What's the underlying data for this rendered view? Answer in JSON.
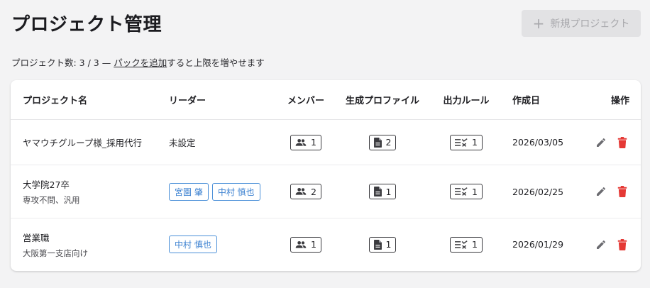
{
  "header": {
    "title": "プロジェクト管理",
    "new_button": "新規プロジェクト",
    "count_prefix": "プロジェクト数: 3 / 3 — ",
    "count_link": "パックを追加",
    "count_suffix": "すると上限を増やせます"
  },
  "table": {
    "columns": {
      "name": "プロジェクト名",
      "leader": "リーダー",
      "members": "メンバー",
      "profile": "生成プロファイル",
      "rule": "出力ルール",
      "date": "作成日",
      "ops": "操作"
    },
    "rows": [
      {
        "name": "ヤマウチグループ様_採用代行",
        "sub": "",
        "leader_text": "未設定",
        "leaders": [],
        "members": "1",
        "profiles": "2",
        "rules": "1",
        "date": "2026/03/05"
      },
      {
        "name": "大学院27卒",
        "sub": "専攻不問、汎用",
        "leader_text": "",
        "leaders": [
          "宮園 肇",
          "中村 慎也"
        ],
        "members": "2",
        "profiles": "1",
        "rules": "1",
        "date": "2026/02/25"
      },
      {
        "name": "営業職",
        "sub": "大阪第一支店向け",
        "leader_text": "",
        "leaders": [
          "中村 慎也"
        ],
        "members": "1",
        "profiles": "1",
        "rules": "1",
        "date": "2026/01/29"
      }
    ]
  },
  "colors": {
    "accent": "#3d82d1",
    "delete": "#e53935",
    "edit": "#6b6b70",
    "disabled": "#a8a8ac"
  },
  "icons": {
    "new": "plus-icon",
    "members": "people-icon",
    "profile": "document-icon",
    "rule": "rule-list-icon",
    "edit": "pencil-icon",
    "delete": "trash-icon"
  }
}
